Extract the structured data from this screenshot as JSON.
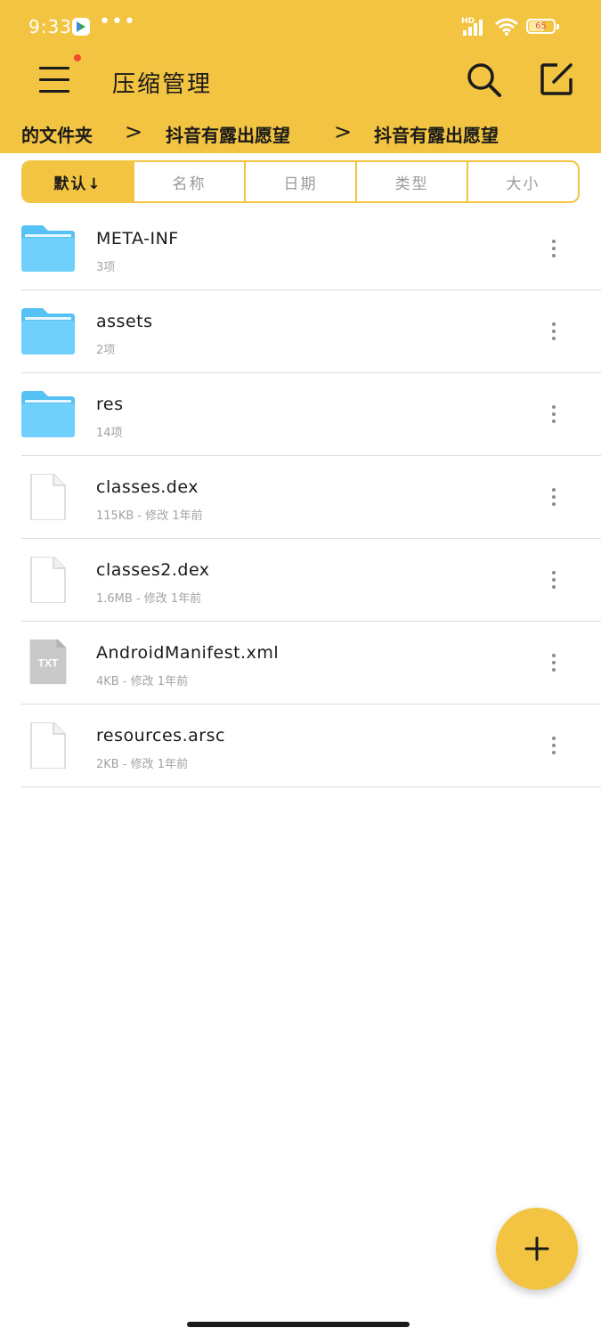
{
  "status_bar": {
    "time": "9:33",
    "overflow": "•••",
    "network_label": "HD",
    "battery": "65"
  },
  "header": {
    "title": "压缩管理",
    "breadcrumb": [
      "的文件夹",
      "抖音有露出愿望",
      "抖音有露出愿望"
    ]
  },
  "sort_tabs": [
    {
      "label": "默认↓",
      "selected": true
    },
    {
      "label": "名称",
      "selected": false
    },
    {
      "label": "日期",
      "selected": false
    },
    {
      "label": "类型",
      "selected": false
    },
    {
      "label": "大小",
      "selected": false
    }
  ],
  "files": [
    {
      "name": "META-INF",
      "meta": "3项",
      "type": "folder"
    },
    {
      "name": "assets",
      "meta": "2项",
      "type": "folder"
    },
    {
      "name": "res",
      "meta": "14项",
      "type": "folder"
    },
    {
      "name": "classes.dex",
      "meta": "115KB - 修改 1年前",
      "type": "file"
    },
    {
      "name": "classes2.dex",
      "meta": "1.6MB - 修改 1年前",
      "type": "file"
    },
    {
      "name": "AndroidManifest.xml",
      "meta": "4KB - 修改 1年前",
      "type": "txt",
      "badge": "TXT"
    },
    {
      "name": "resources.arsc",
      "meta": "2KB - 修改 1年前",
      "type": "file"
    }
  ],
  "colors": {
    "accent": "#f2c441",
    "folder": "#56c1f5",
    "notification_dot": "#f04a2e"
  },
  "icons": {
    "menu": "hamburger-menu-icon",
    "search": "search-icon",
    "edit": "edit-icon",
    "more": "more-vertical-icon",
    "add": "plus-icon"
  }
}
